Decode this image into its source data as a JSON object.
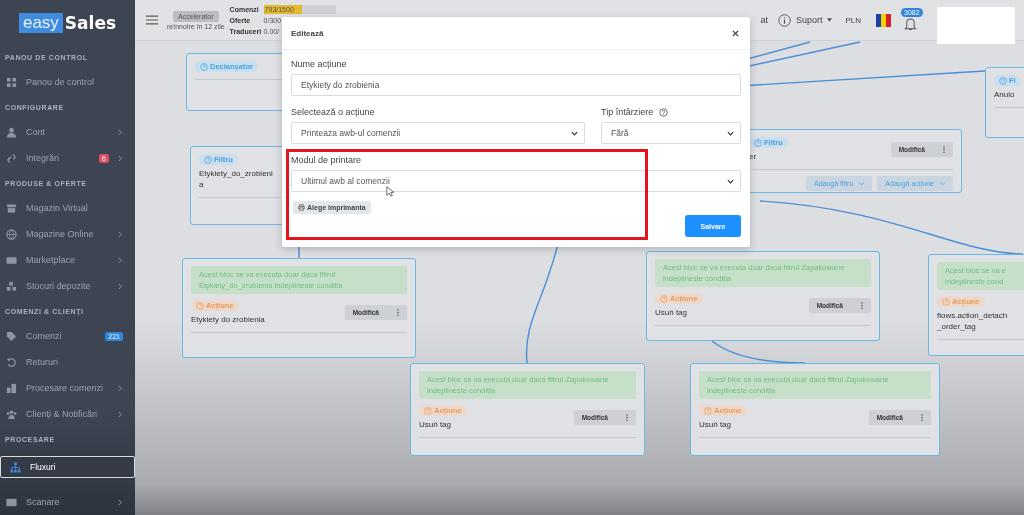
{
  "sidebar": {
    "logo": {
      "part1": "easy",
      "part2": "Sales"
    },
    "sections": [
      {
        "title": "PANOU DE CONTROL",
        "items": [
          {
            "label": "Panou de control",
            "expandable": false,
            "selected": false
          }
        ]
      },
      {
        "title": "CONFIGURARE",
        "items": [
          {
            "label": "Cont",
            "expandable": true,
            "selected": false
          },
          {
            "label": "Integrări",
            "expandable": true,
            "selected": false,
            "badge": {
              "text": "6",
              "color": "#d9505f"
            }
          }
        ]
      },
      {
        "title": "PRODUSE & OFERTE",
        "items": [
          {
            "label": "Magazin Virtual",
            "expandable": false,
            "selected": false
          },
          {
            "label": "Magazine Online",
            "expandable": true,
            "selected": false
          },
          {
            "label": "Marketplace",
            "expandable": true,
            "selected": false
          },
          {
            "label": "Stocuri depozite",
            "expandable": true,
            "selected": false
          }
        ]
      },
      {
        "title": "COMENZI & CLIENȚI",
        "items": [
          {
            "label": "Comenzi",
            "expandable": false,
            "selected": false,
            "badge": {
              "text": "221",
              "color": "#2f86d6"
            }
          },
          {
            "label": "Retururi",
            "expandable": false,
            "selected": false
          },
          {
            "label": "Procesare comenzi",
            "expandable": true,
            "selected": false
          },
          {
            "label": "Clienți & Notificări",
            "expandable": true,
            "selected": false
          }
        ]
      },
      {
        "title": "PROCESARE",
        "items": [
          {
            "label": "Fluxuri",
            "expandable": false,
            "selected": true
          },
          {
            "label": "Scanare",
            "expandable": true,
            "selected": false
          }
        ]
      }
    ]
  },
  "topbar": {
    "accelerator": {
      "label": "Accelerator",
      "note": "reînnoire în 12 zile"
    },
    "stats": [
      {
        "label": "Comenzi",
        "value": "793/1500",
        "level": 0.53
      },
      {
        "label": "Oferte",
        "value": "0/300"
      },
      {
        "label": "Traduceri",
        "value": "0.00/"
      }
    ],
    "chat": "at",
    "support": "Suport",
    "currency": "PLN",
    "notifications": "3082"
  },
  "nodes": [
    {
      "kind": "trigger",
      "badge": "Declanșator"
    },
    {
      "kind": "filter",
      "badge": "Filtru",
      "title": "Etykiety_do_zrobienia"
    },
    {
      "kind": "action",
      "note": "Acest bloc se va executa doar daca filtrul Etykiety_do_zrobienia indeplineste conditia",
      "badge": "Acțiune",
      "title": "Etykiety do zrobienia",
      "modify": "Modifică"
    },
    {
      "kind": "filter",
      "badge": "Filtru",
      "title": "er",
      "modify": "Modifică",
      "add_buttons": [
        "Adaugă filtru",
        "Adaugă acțiune"
      ]
    },
    {
      "kind": "action",
      "note": "Acest bloc se va executa doar daca filtrul Zapakowane indeplineste conditia",
      "badge": "Acțiune",
      "title": "Usuń tag",
      "modify": "Modifică"
    },
    {
      "kind": "action",
      "note_lines": [
        "Acest bloc se va e",
        "indeplineste cond"
      ],
      "badge": "Acțiune",
      "title": "flows.action_detach_order_tag"
    },
    {
      "kind": "action",
      "note": "Acest bloc se va executa doar daca filtrul Zapakowane indeplineste conditia",
      "badge": "Acțiune",
      "title": "Usuń tag",
      "modify": "Modifică"
    },
    {
      "kind": "action",
      "note": "Acest bloc se va executa doar daca filtrul Zapakowane indeplineste conditia",
      "badge": "Acțiune",
      "title": "Usuń tag",
      "modify": "Modifică"
    },
    {
      "kind": "filter",
      "badge": "Fi",
      "title": "Anulo"
    }
  ],
  "modal": {
    "title": "Editează",
    "name_field": {
      "label": "Nume acțiune",
      "value": "Etykiety do zrobienia"
    },
    "action_field": {
      "label": "Selectează o acțiune",
      "value": "Printeaza awb-ul comenzii"
    },
    "delay_field": {
      "label": "Tip întârziere",
      "value": "Fără"
    },
    "print_mode_field": {
      "label": "Modul de printare",
      "value": "Ultimul awb al comenzii",
      "highlighted": true
    },
    "printer_button": "Alege imprimanta",
    "save_button": "Salvare"
  }
}
